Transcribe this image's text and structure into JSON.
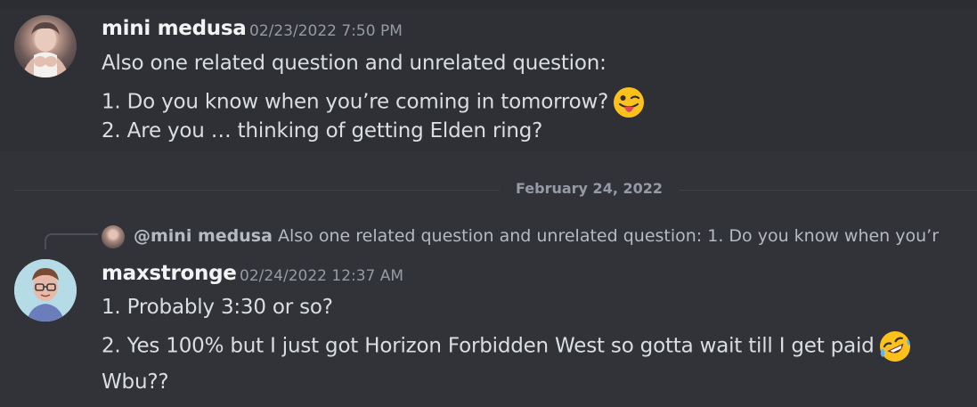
{
  "messages": [
    {
      "username": "mini medusa",
      "timestamp": "02/23/2022 7:50 PM",
      "lines": [
        "Also one related question and unrelated question:",
        "1. Do you know when you’re coming in tomorrow?",
        "2. Are you … thinking of getting Elden ring?"
      ],
      "emoji": "winking-face-with-tongue"
    },
    {
      "username": "maxstronge",
      "timestamp": "02/24/2022 12:37 AM",
      "reply": {
        "mention": "@mini medusa",
        "preview": "Also one related question and unrelated question: 1. Do you know when you’r"
      },
      "lines": [
        "1. Probably 3:30 or so?",
        "2. Yes 100% but I just got Horizon Forbidden West so gotta wait till I get paid",
        "Wbu??"
      ],
      "emoji": "rolling-on-the-floor-laughing"
    }
  ],
  "date_divider": "February 24, 2022",
  "colors": {
    "background": "#313338",
    "highlighted_message": "#2e3035",
    "text": "#dbdee1",
    "muted": "#949ba4"
  }
}
